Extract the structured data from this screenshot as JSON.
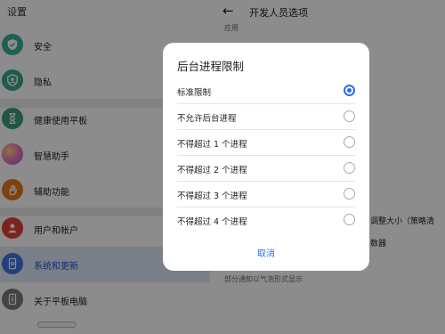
{
  "settings": {
    "title": "设置",
    "items": [
      {
        "label": "安全",
        "icon": "shield-check-icon",
        "color": "#3dad96"
      },
      {
        "label": "隐私",
        "icon": "privacy-shield-icon",
        "color": "#3aa78f"
      },
      {
        "label": "健康使用平板",
        "icon": "hourglass-icon",
        "color": "#3c9c7c"
      },
      {
        "label": "智慧助手",
        "icon": "assistant-orb-icon",
        "color": "#d26ad0"
      },
      {
        "label": "辅助功能",
        "icon": "hand-icon",
        "color": "#e8781a"
      },
      {
        "label": "用户和帐户",
        "icon": "user-icon",
        "color": "#e04336"
      },
      {
        "label": "系统和更新",
        "icon": "tablet-update-icon",
        "color": "#3f76e4"
      },
      {
        "label": "关于平板电脑",
        "icon": "tablet-info-icon",
        "color": "#7a7a7a"
      }
    ],
    "active_index": 6
  },
  "developer": {
    "title": "开发人员选项",
    "section": "应用",
    "frag_1": "调整大小（策略清",
    "frag_2": "数器",
    "footer": "部分通知以气泡形式显示"
  },
  "dialog": {
    "title": "后台进程限制",
    "options": [
      "标准限制",
      "不允许后台进程",
      "不得超过 1 个进程",
      "不得超过 2 个进程",
      "不得超过 3 个进程",
      "不得超过 4 个进程"
    ],
    "selected_index": 0,
    "cancel_label": "取消"
  }
}
